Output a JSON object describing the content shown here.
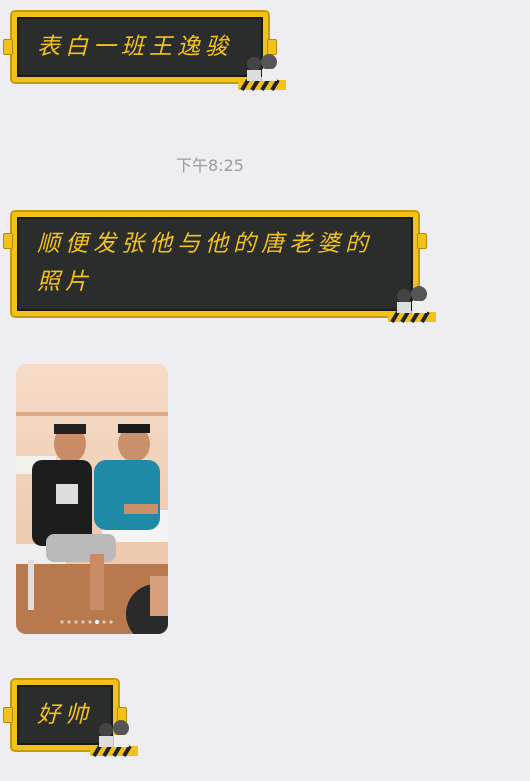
{
  "messages": [
    {
      "text": "表白一班王逸骏"
    },
    {
      "text": "顺便发张他与他的唐老婆的照片"
    },
    {
      "text": "好帅"
    }
  ],
  "timestamp": "下午8:25",
  "photo": {
    "page_dots": 8,
    "active_dot": 5
  },
  "colors": {
    "bubble_bg": "#2b2d2d",
    "bubble_border": "#f2c21b",
    "background": "#ededf2"
  }
}
